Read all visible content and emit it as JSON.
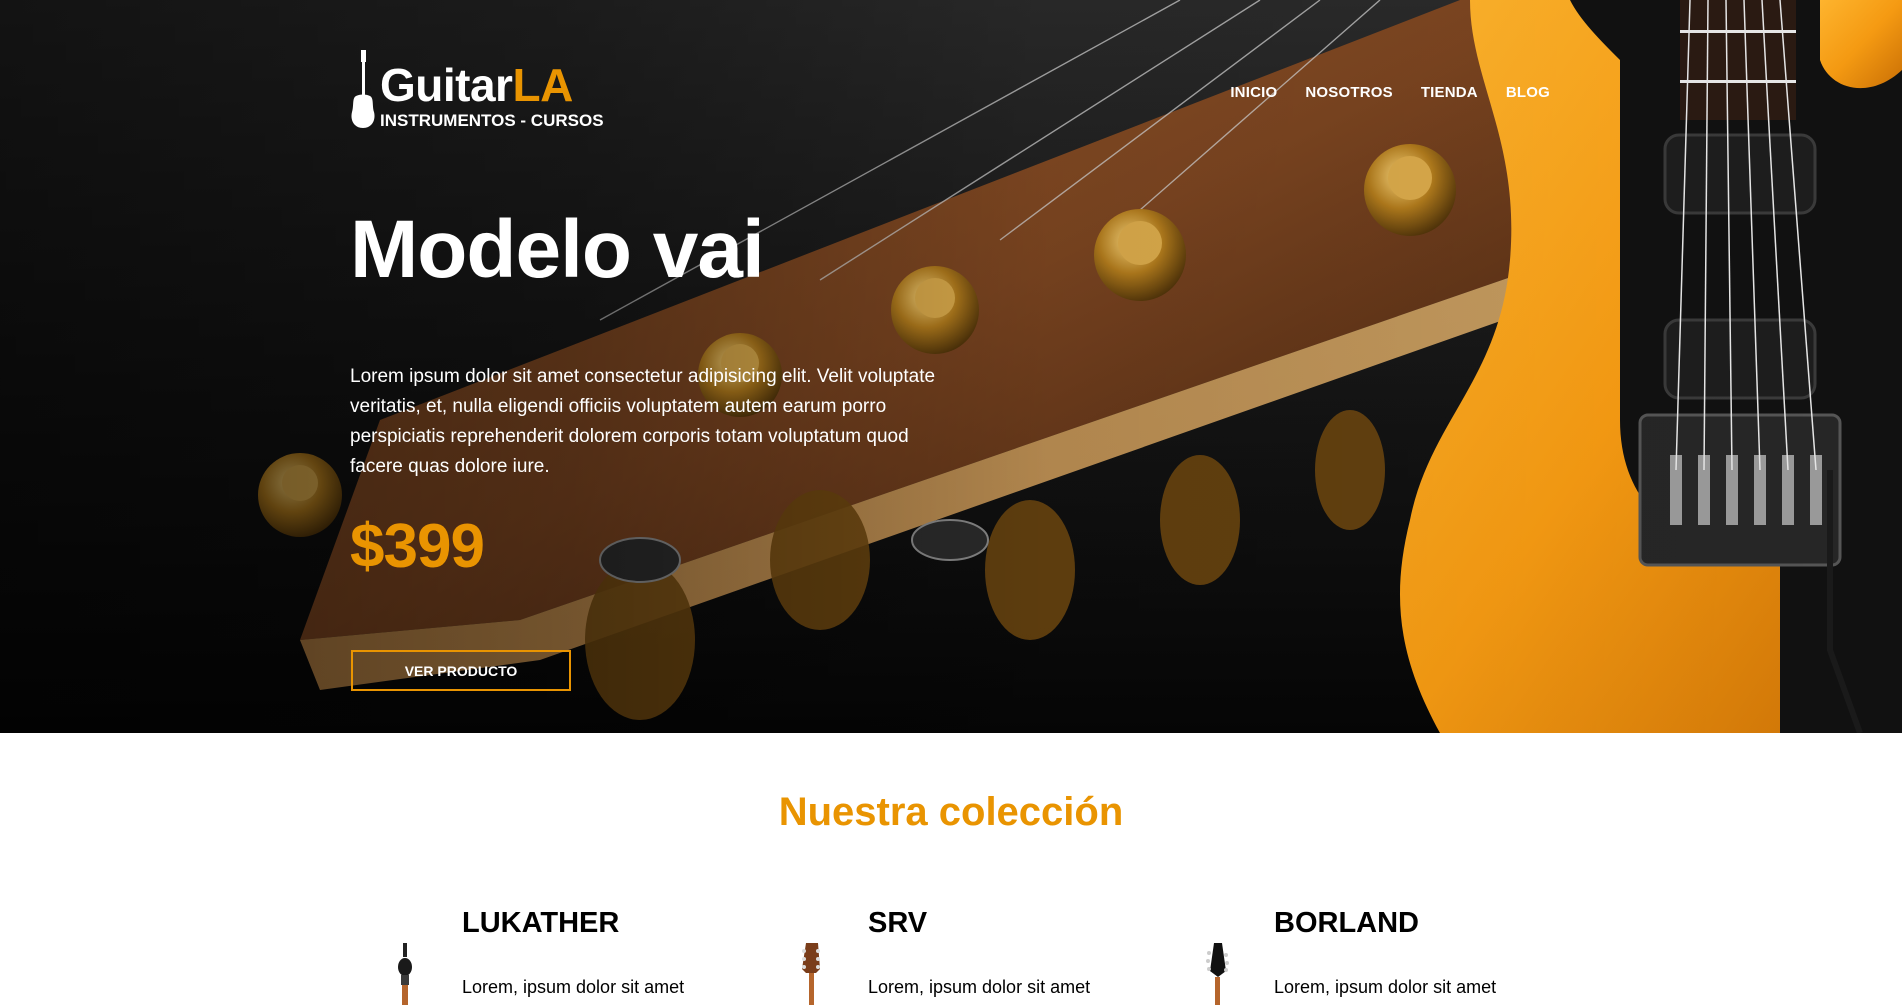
{
  "brand": {
    "name_main": "Guitar",
    "name_accent": "LA",
    "tagline": "INSTRUMENTOS - CURSOS"
  },
  "nav": {
    "items": [
      {
        "label": "INICIO"
      },
      {
        "label": "NOSOTROS"
      },
      {
        "label": "TIENDA"
      },
      {
        "label": "BLOG"
      }
    ]
  },
  "hero": {
    "title": "Modelo vai",
    "description": "Lorem ipsum dolor sit amet consectetur adipisicing elit. Velit voluptate veritatis, et, nulla eligendi officiis voluptatem autem earum porro perspiciatis reprehenderit dolorem corporis totam voluptatum quod facere quas dolore iure.",
    "price": "$399",
    "button_label": "VER PRODUCTO"
  },
  "collection": {
    "title": "Nuestra colección",
    "products": [
      {
        "name": "LUKATHER",
        "description": "Lorem, ipsum dolor sit amet"
      },
      {
        "name": "SRV",
        "description": "Lorem, ipsum dolor sit amet"
      },
      {
        "name": "BORLAND",
        "description": "Lorem, ipsum dolor sit amet"
      }
    ]
  },
  "colors": {
    "accent": "#e99401",
    "hero_text": "#ffffff",
    "guitar_body": "#f5a11c"
  }
}
